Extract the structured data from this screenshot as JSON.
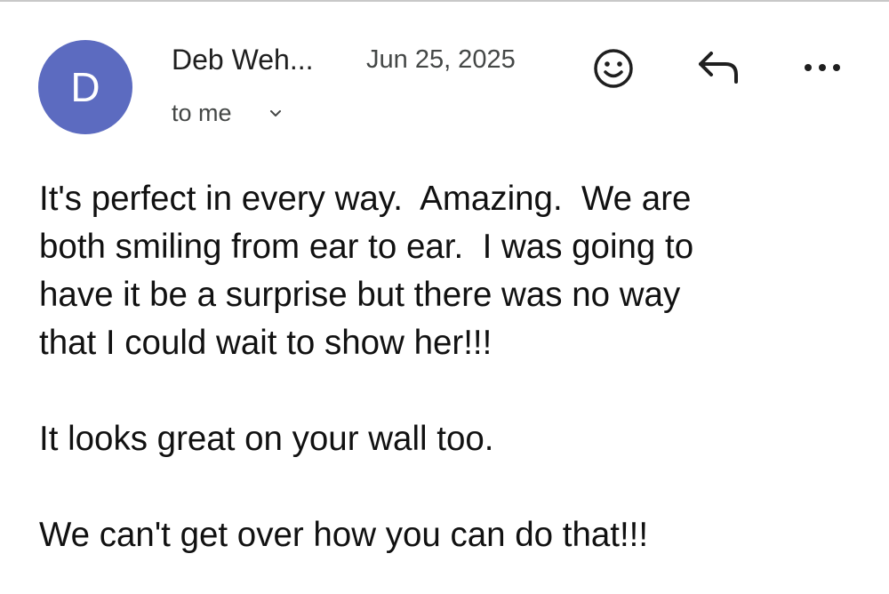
{
  "email": {
    "avatar_letter": "D",
    "sender": "Deb Weh...",
    "date": "Jun 25, 2025",
    "recipient": "to me",
    "body": {
      "paragraph1": [
        "It's perfect in every way.  Amazing.  We are",
        "both smiling from ear to ear.  I was going to",
        "have it be a surprise but there was no way",
        "that I could wait to show her!!!"
      ],
      "paragraph2": "It looks great on your wall too.",
      "paragraph3": "We can't get over how you can do that!!!"
    }
  },
  "icons": {
    "emoji": "smiley-icon",
    "reply": "reply-arrow-icon",
    "more": "more-horizontal-icon",
    "expand": "chevron-down-icon"
  },
  "colors": {
    "avatar_bg": "#5c6bc0",
    "text_primary": "#1f1f1f",
    "text_secondary": "#444746"
  }
}
